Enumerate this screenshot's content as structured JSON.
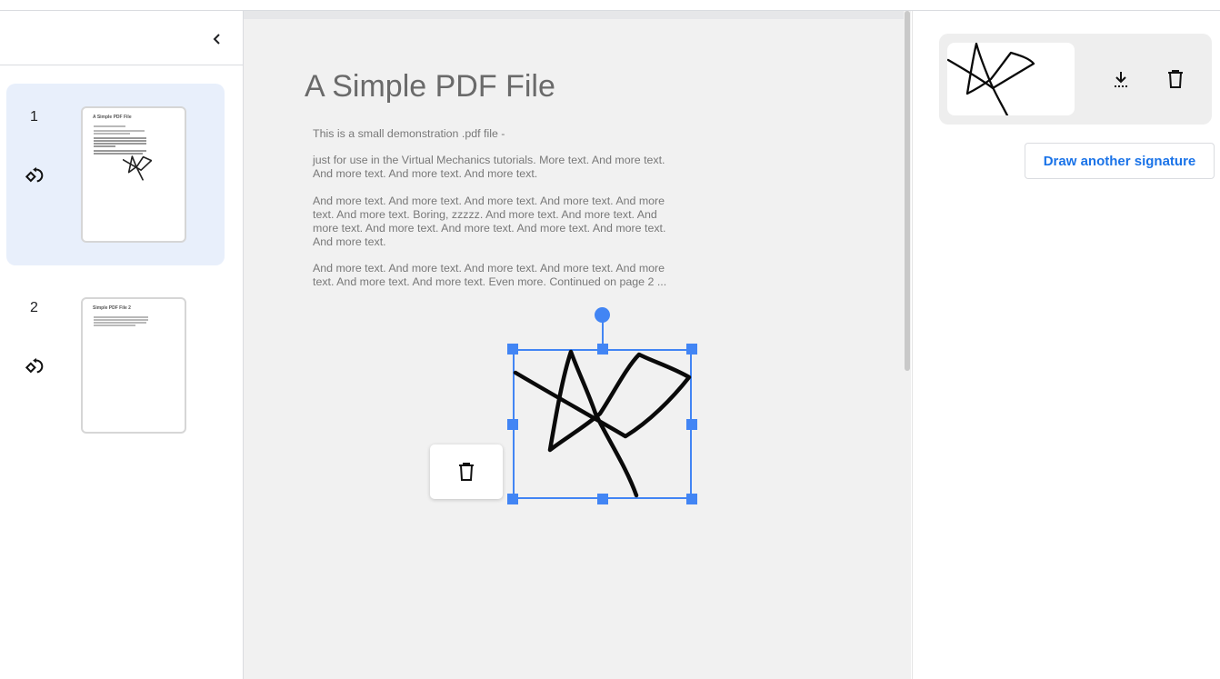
{
  "sidebar": {
    "collapse_icon": "chevron-left-icon",
    "pages": [
      {
        "number": "1",
        "selected": true,
        "rotate_icon": "rotate-left-icon",
        "thumb_title": "A Simple PDF File",
        "has_signature": true
      },
      {
        "number": "2",
        "selected": false,
        "rotate_icon": "rotate-left-icon",
        "thumb_title": "Simple PDF File 2",
        "has_signature": false
      }
    ]
  },
  "document": {
    "title": "A Simple PDF File",
    "paragraphs": [
      "This is a small demonstration .pdf file -",
      "just for use in the Virtual Mechanics tutorials. More text. And more text. And more text. And more text. And more text.",
      "And more text. And more text. And more text. And more text. And more text. And more text. Boring, zzzzz. And more text. And more text. And more text. And more text. And more text. And more text. And more text. And more text.",
      "And more text. And more text. And more text. And more text. And more text. And more text. And more text. Even more. Continued on page 2 ..."
    ],
    "placed_signature": {
      "selected": true,
      "delete_icon": "trash-icon"
    }
  },
  "signature_panel": {
    "download_icon": "download-icon",
    "delete_icon": "trash-icon",
    "draw_another_label": "Draw another signature",
    "accent_color": "#1a73e8"
  },
  "colors": {
    "selection_blue": "#4285f4",
    "selected_thumb_bg": "#e8effb"
  }
}
